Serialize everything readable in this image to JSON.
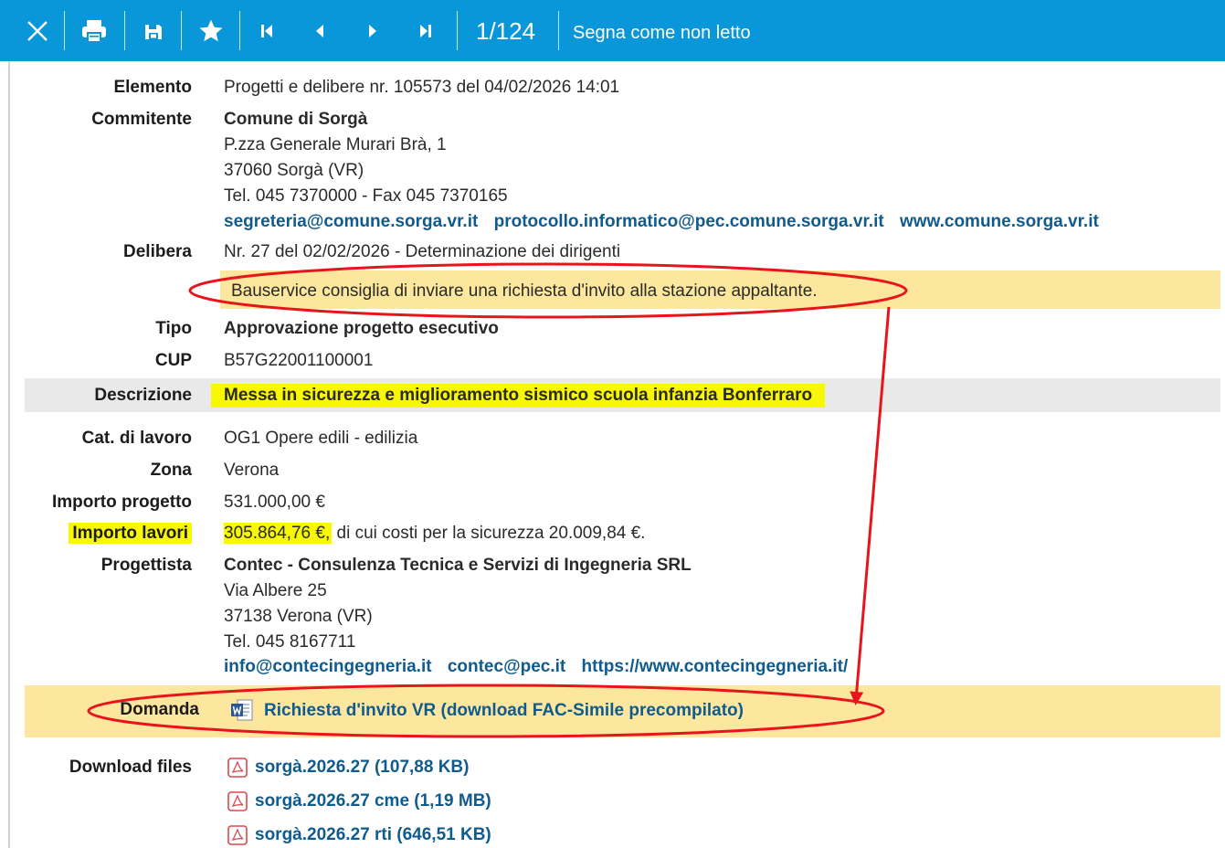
{
  "toolbar": {
    "counter": "1/124",
    "mark_unread": "Segna come non letto",
    "icons": [
      "close-icon",
      "print-icon",
      "save-icon",
      "star-icon",
      "first-page-icon",
      "prev-page-icon",
      "next-page-icon",
      "last-page-icon"
    ],
    "color": "#0a97d9"
  },
  "elemento": {
    "label": "Elemento",
    "value": "Progetti e delibere nr. 105573 del 04/02/2026 14:01"
  },
  "committente": {
    "label": "Commitente",
    "name": "Comune di Sorgà",
    "address": "P.zza Generale Murari Brà, 1",
    "city": "37060 Sorgà (VR)",
    "phone": "Tel. 045 7370000 - Fax 045 7370165",
    "email": "segreteria@comune.sorga.vr.it",
    "pec": "protocollo.informatico@pec.comune.sorga.vr.it",
    "web": "www.comune.sorga.vr.it"
  },
  "delibera": {
    "label": "Delibera",
    "value": "Nr. 27 del 02/02/2026 - Determinazione dei dirigenti",
    "notice": "Bauservice consiglia di inviare una richiesta d'invito alla stazione appaltante."
  },
  "tipo": {
    "label": "Tipo",
    "value": "Approvazione progetto esecutivo"
  },
  "cup": {
    "label": "CUP",
    "value": "B57G22001100001"
  },
  "descrizione": {
    "label": "Descrizione",
    "value": "Messa in sicurezza e miglioramento sismico scuola infanzia Bonferraro"
  },
  "categoria": {
    "label": "Cat. di lavoro",
    "value": "OG1 Opere edili - edilizia"
  },
  "zona": {
    "label": "Zona",
    "value": "Verona"
  },
  "importo_progetto": {
    "label": "Importo progetto",
    "value": "531.000,00 €"
  },
  "importo_lavori": {
    "label": "Importo lavori",
    "amount": "305.864,76 €,",
    "rest": " di cui costi per la sicurezza 20.009,84 €."
  },
  "progettista": {
    "label": "Progettista",
    "name": "Contec - Consulenza Tecnica e Servizi di Ingegneria SRL",
    "address": "Via Albere 25",
    "city": "37138 Verona (VR)",
    "phone": "Tel. 045 8167711",
    "email": "info@contecingegneria.it",
    "pec": "contec@pec.it",
    "web": "https://www.contecingegneria.it/"
  },
  "domanda": {
    "label": "Domanda",
    "link": "Richiesta d'invito VR (download FAC-Simile precompilato)"
  },
  "download": {
    "label": "Download files",
    "files": [
      "sorgà.2026.27 (107,88 KB)",
      "sorgà.2026.27 cme (1,19 MB)",
      "sorgà.2026.27 rti (646,51 KB)"
    ]
  },
  "colors": {
    "notice_band": "#fde69d",
    "highlight": "#f8f800",
    "link": "#105b8e",
    "annotation": "#e8141c"
  }
}
